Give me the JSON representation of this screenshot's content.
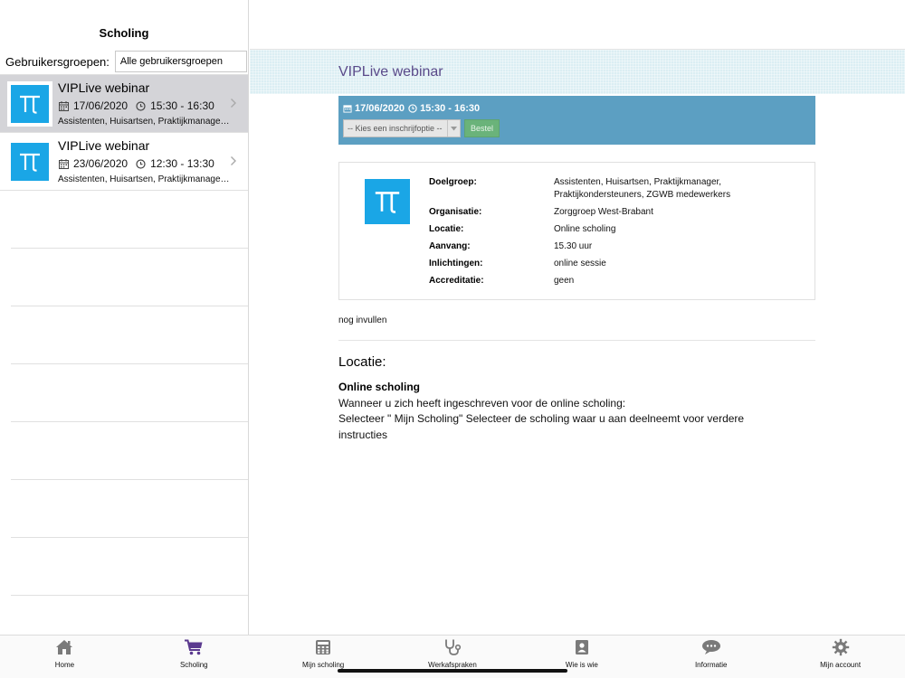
{
  "sidebar": {
    "title": "Scholing",
    "filter_label": "Gebruikersgroepen:",
    "filter_value": "Alle gebruikersgroepen",
    "items": [
      {
        "title": "VIPLive webinar",
        "date": "17/06/2020",
        "time": "15:30 - 16:30",
        "groups": "Assistenten, Huisartsen, Praktijkmanager, Praktijkondersteuners, ZGWB medewerkers",
        "selected": true
      },
      {
        "title": "VIPLive webinar",
        "date": "23/06/2020",
        "time": "12:30 - 13:30",
        "groups": "Assistenten, Huisartsen, Praktijkmanager, Praktijkondersteuners, ZGWB medewerkers",
        "selected": false
      }
    ]
  },
  "main": {
    "title": "VIPLive webinar",
    "session": {
      "date": "17/06/2020",
      "time": "15:30 - 16:30",
      "select_placeholder": "-- Kies een inschrijfoptie --",
      "order_button": "Bestel"
    },
    "details": [
      {
        "key": "Doelgroep:",
        "value": "Assistenten, Huisartsen, Praktijkmanager, Praktijkondersteuners, ZGWB medewerkers"
      },
      {
        "key": "Organisatie:",
        "value": "Zorggroep West-Brabant"
      },
      {
        "key": "Locatie:",
        "value": "Online scholing"
      },
      {
        "key": "Aanvang:",
        "value": "15.30 uur"
      },
      {
        "key": "Inlichtingen:",
        "value": "online sessie"
      },
      {
        "key": "Accreditatie:",
        "value": "geen"
      }
    ],
    "note": "nog invullen",
    "location_heading": "Locatie:",
    "location_name": "Online scholing",
    "location_line1": "Wanneer u zich heeft ingeschreven voor de online scholing:",
    "location_line2": "Selecteer \" Mijn Scholing\" Selecteer de scholing waar u aan deelneemt voor verdere instructies"
  },
  "tabbar": {
    "active_color": "#5b3a8f",
    "inactive_color": "#7a7a7a",
    "tabs": [
      {
        "label": "Home",
        "icon": "home-icon",
        "active": false
      },
      {
        "label": "Scholing",
        "icon": "cart-icon",
        "active": true
      },
      {
        "label": "Mijn scholing",
        "icon": "calculator-icon",
        "active": false
      },
      {
        "label": "Werkafspraken",
        "icon": "stethoscope-icon",
        "active": false
      },
      {
        "label": "Wie is wie",
        "icon": "contact-icon",
        "active": false
      },
      {
        "label": "Informatie",
        "icon": "chat-icon",
        "active": false
      },
      {
        "label": "Mijn account",
        "icon": "gear-icon",
        "active": false
      }
    ]
  }
}
